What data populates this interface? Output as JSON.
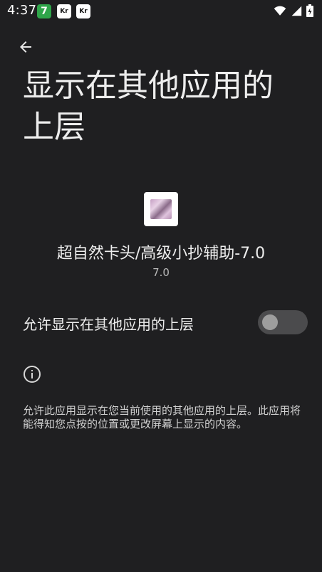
{
  "status_bar": {
    "time": "4:37",
    "notifications": [
      "7",
      "Kr",
      "Kr"
    ]
  },
  "page": {
    "title": "显示在其他应用的上层"
  },
  "app": {
    "name": "超自然卡头/高级小抄辅助-7.0",
    "version": "7.0"
  },
  "permission": {
    "label": "允许显示在其他应用的上层",
    "enabled": false
  },
  "info": {
    "description": "允许此应用显示在您当前使用的其他应用的上层。此应用将能得知您点按的位置或更改屏幕上显示的内容。"
  }
}
